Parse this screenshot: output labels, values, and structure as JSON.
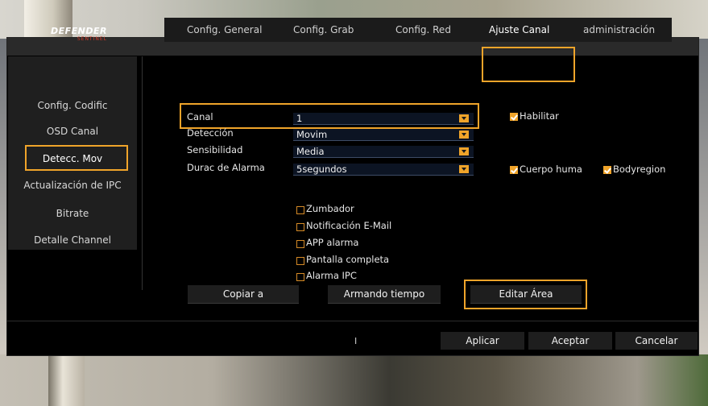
{
  "logo": {
    "brand": "DEFENDER",
    "sub": "SENTINEL"
  },
  "tabs": [
    {
      "label": "Config. General"
    },
    {
      "label": "Config. Grab"
    },
    {
      "label": "Config. Red"
    },
    {
      "label": "Ajuste Canal"
    },
    {
      "label": "administración"
    }
  ],
  "sidebar": {
    "items": [
      {
        "label": "Config. Codific"
      },
      {
        "label": "OSD Canal"
      },
      {
        "label": "Detecc. Mov"
      },
      {
        "label": "Actualización de IPC"
      },
      {
        "label": "Bitrate"
      },
      {
        "label": "Detalle Channel"
      }
    ]
  },
  "form": {
    "canal": {
      "label": "Canal",
      "value": "1"
    },
    "deteccion": {
      "label": "Detección",
      "value": "Movim"
    },
    "sensibilidad": {
      "label": "Sensibilidad",
      "value": "Media"
    },
    "durac": {
      "label": "Durac de Alarma",
      "value": "5segundos"
    },
    "habilitar": {
      "label": "Habilitar",
      "checked": true
    },
    "cuerpo": {
      "label": "Cuerpo huma",
      "checked": true
    },
    "bodyregion": {
      "label": "Bodyregion",
      "checked": true
    },
    "zumbador": {
      "label": "Zumbador",
      "checked": false
    },
    "email": {
      "label": "Notificación E-Mail",
      "checked": false
    },
    "app": {
      "label": "APP alarma",
      "checked": false
    },
    "pantalla": {
      "label": "Pantalla completa",
      "checked": false
    },
    "alarma_ipc": {
      "label": "Alarma IPC",
      "checked": false
    }
  },
  "buttons": {
    "copiar": "Copiar a",
    "armando": "Armando tiempo",
    "editar": "Editar Área"
  },
  "footer": {
    "aplicar": "Aplicar",
    "aceptar": "Aceptar",
    "cancelar": "Cancelar",
    "cursor": "I"
  },
  "colors": {
    "accent": "#f0a42a",
    "panel": "#000000",
    "sidebar": "#1f1f1f"
  }
}
